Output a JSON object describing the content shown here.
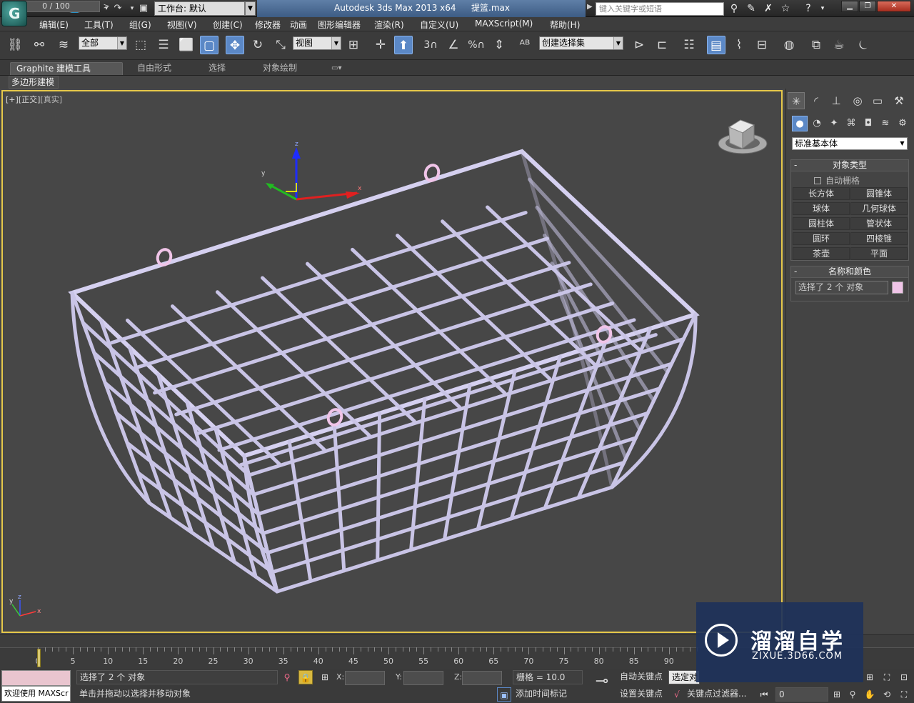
{
  "titlebar": {
    "workspace": "工作台: 默认",
    "app_title": "Autodesk 3ds Max  2013 x64",
    "file_name": "提篮.max",
    "search_placeholder": "键入关键字或短语"
  },
  "menu": [
    "编辑(E)",
    "工具(T)",
    "组(G)",
    "视图(V)",
    "创建(C)",
    "修改器",
    "动画",
    "图形编辑器",
    "渲染(R)",
    "自定义(U)",
    "MAXScript(M)",
    "帮助(H)"
  ],
  "toolbar": {
    "filter_value": "全部",
    "ref_coord_value": "视图",
    "snap_labels": [
      "3",
      "%"
    ],
    "selection_set_value": "创建选择集"
  },
  "ribbon": {
    "tabs": [
      "Graphite 建模工具",
      "自由形式",
      "选择",
      "对象绘制"
    ],
    "subtab": "多边形建模"
  },
  "viewport": {
    "label_plus": "[+]",
    "label_view": "[正交]",
    "label_shading": "[真实]",
    "axis_x": "x",
    "axis_y": "y",
    "axis_z": "z"
  },
  "command_panel": {
    "category": "标准基本体",
    "object_type_title": "对象类型",
    "autogrid_label": "自动栅格",
    "object_buttons": [
      "长方体",
      "圆锥体",
      "球体",
      "几何球体",
      "圆柱体",
      "管状体",
      "圆环",
      "四棱锥",
      "茶壶",
      "平面"
    ],
    "name_color_title": "名称和颜色",
    "name_value": "选择了 2 个 对象",
    "swatch_color": "#f0c4e8"
  },
  "timeline": {
    "slider_label": "0 / 100",
    "ticks": [
      0,
      5,
      10,
      15,
      20,
      25,
      30,
      35,
      40,
      45,
      50,
      55,
      60,
      65,
      70,
      75,
      80,
      85,
      90
    ]
  },
  "status": {
    "selected": "选择了 2 个 对象",
    "prompt": "单击并拖动以选择并移动对象",
    "welcome": "欢迎使用 MAXScr",
    "coord_x_label": "X:",
    "coord_y_label": "Y:",
    "coord_z_label": "Z:",
    "grid": "栅格 = 10.0",
    "add_time_tag": "添加时间标记",
    "auto_key": "自动关键点",
    "set_key": "设置关键点",
    "selected_dropdown": "选定对",
    "key_filter": "关键点过滤器...",
    "frame": "0"
  },
  "watermark": {
    "title": "溜溜自学",
    "url": "ZIXUE.3D66.COM"
  },
  "colors": {
    "accent": "#5b88c6",
    "viewport_border": "#e6c84a",
    "basket": "#c9c4e6"
  }
}
